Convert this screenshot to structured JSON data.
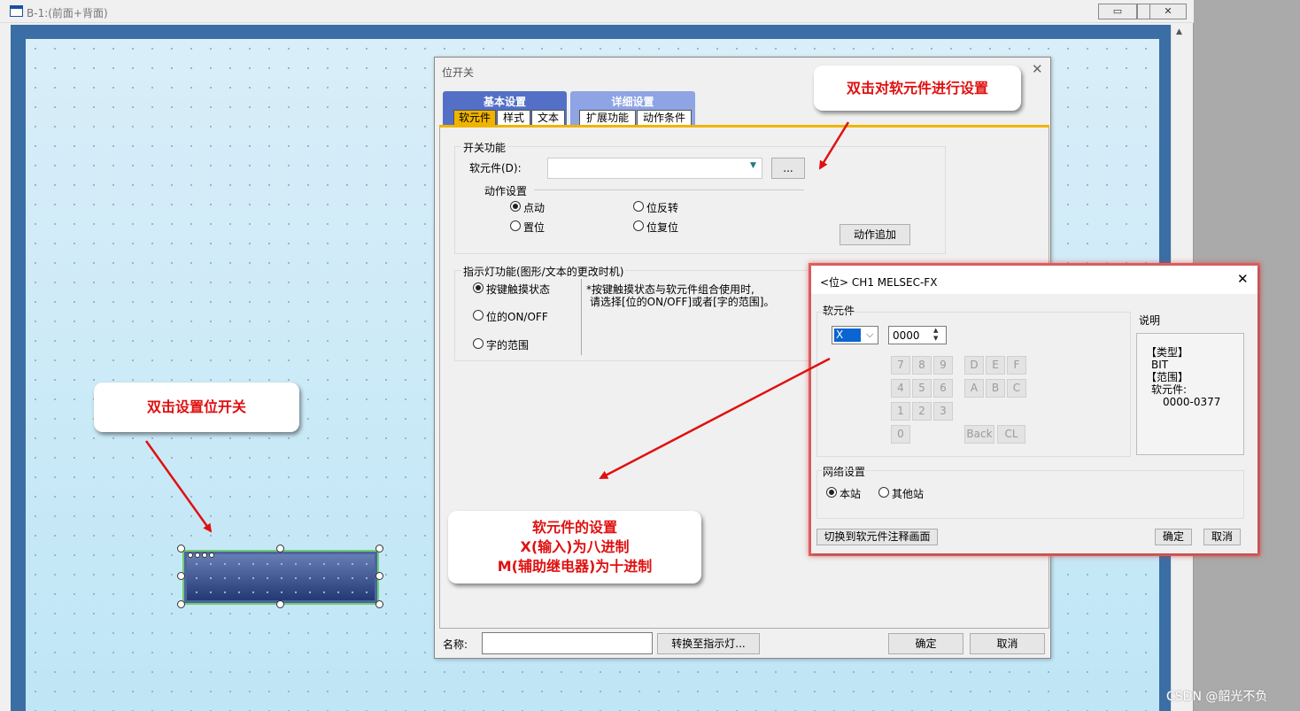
{
  "outer_window": {
    "title": "B-1:(前面+背面)",
    "buttons": {
      "minimize": "▭",
      "restore": "▣",
      "close": "✕"
    }
  },
  "callouts": {
    "set_switch": "双击设置位开关",
    "device_setting": "双击对软元件进行设置",
    "device_note_line1": "软元件的设置",
    "device_note_line2": "X(输入)为八进制",
    "device_note_line3": "M(辅助继电器)为十进制"
  },
  "bit_switch_dialog": {
    "title": "位开关",
    "close": "✕",
    "tab_groups": [
      {
        "label": "基本设置",
        "tabs": [
          "软元件",
          "样式",
          "文本"
        ]
      },
      {
        "label": "详细设置",
        "tabs": [
          "扩展功能",
          "动作条件"
        ]
      }
    ],
    "switch_function": {
      "group_label": "开关功能",
      "device_label": "软元件(D):",
      "device_value": "",
      "browse_label": "...",
      "action_group_label": "动作设置",
      "actions": [
        {
          "label": "点动",
          "selected": true
        },
        {
          "label": "位反转",
          "selected": false
        },
        {
          "label": "置位",
          "selected": false
        },
        {
          "label": "位复位",
          "selected": false
        }
      ],
      "add_action_label": "动作追加"
    },
    "indicator_function": {
      "group_label": "指示灯功能(图形/文本的更改时机)",
      "options": [
        {
          "label": "按键触摸状态",
          "selected": true
        },
        {
          "label": "位的ON/OFF",
          "selected": false
        },
        {
          "label": "字的范围",
          "selected": false
        }
      ],
      "note_line1": "*按键触摸状态与软元件组合使用时,",
      "note_line2": "请选择[位的ON/OFF]或者[字的范围]。"
    },
    "name_label": "名称:",
    "name_value": "",
    "convert_label": "转换至指示灯...",
    "ok_label": "确定",
    "cancel_label": "取消"
  },
  "device_dialog": {
    "title": "<位> CH1 MELSEC-FX",
    "close": "✕",
    "device_group_label": "软元件",
    "device_type": "X",
    "device_number": "0000",
    "keypad": {
      "digits": [
        "7",
        "8",
        "9",
        "4",
        "5",
        "6",
        "1",
        "2",
        "3",
        "0"
      ],
      "hex": [
        "D",
        "E",
        "F",
        "A",
        "B",
        "C"
      ],
      "back_label": "Back",
      "clear_label": "CL"
    },
    "explanation_label": "说明",
    "explanation": {
      "type_header": "【类型】",
      "type_value": "BIT",
      "range_header": "【范围】",
      "range_label": "软元件:",
      "range_value": "0000-0377"
    },
    "network_group_label": "网络设置",
    "network_options": [
      {
        "label": "本站",
        "selected": true
      },
      {
        "label": "其他站",
        "selected": false
      }
    ],
    "switch_comment_label": "切换到软元件注释画面",
    "ok_label": "确定",
    "cancel_label": "取消"
  },
  "watermark": "CSDN @韶光不负",
  "colors": {
    "annotation_red": "#e01010",
    "tab_blue": "#5470c6",
    "tab_yellow": "#f0b400",
    "highlight_border": "#e06060"
  }
}
